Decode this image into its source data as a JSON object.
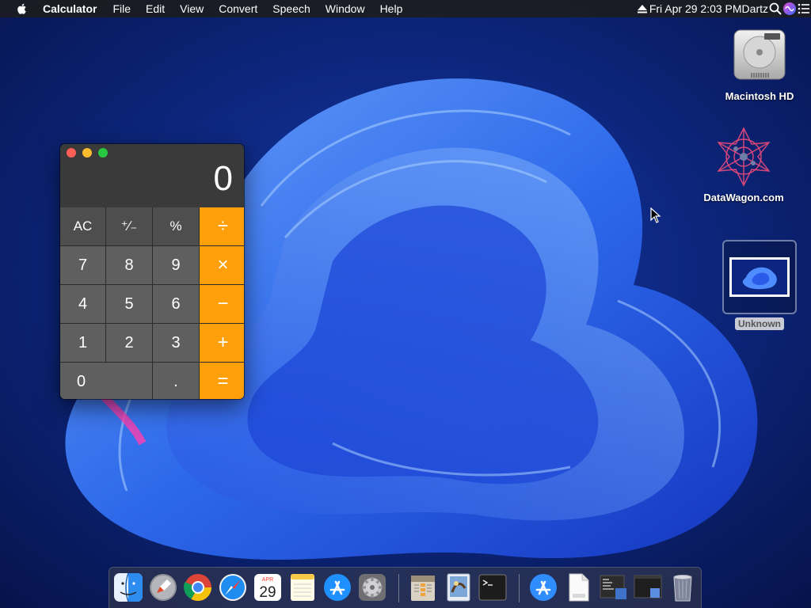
{
  "menubar": {
    "app_name": "Calculator",
    "menus": [
      "File",
      "Edit",
      "View",
      "Convert",
      "Speech",
      "Window",
      "Help"
    ],
    "clock": "Fri Apr 29  2:03 PM",
    "user": "Dartz",
    "icons": [
      "apple-icon",
      "eject-icon",
      "search-icon",
      "siri-icon",
      "control-center-icon"
    ]
  },
  "desktop": {
    "icons": [
      {
        "label": "Macintosh HD",
        "icon": "hard-drive-icon"
      },
      {
        "label": "DataWagon.com",
        "icon": "network-icon"
      },
      {
        "label": "Unknown",
        "icon": "image-thumbnail-icon"
      }
    ]
  },
  "calculator": {
    "display": "0",
    "keys": [
      {
        "label": "AC",
        "kind": "fn"
      },
      {
        "label": "⁺∕₋",
        "kind": "fn"
      },
      {
        "label": "%",
        "kind": "fn"
      },
      {
        "label": "÷",
        "kind": "op"
      },
      {
        "label": "7",
        "kind": "num"
      },
      {
        "label": "8",
        "kind": "num"
      },
      {
        "label": "9",
        "kind": "num"
      },
      {
        "label": "×",
        "kind": "op"
      },
      {
        "label": "4",
        "kind": "num"
      },
      {
        "label": "5",
        "kind": "num"
      },
      {
        "label": "6",
        "kind": "num"
      },
      {
        "label": "−",
        "kind": "op"
      },
      {
        "label": "1",
        "kind": "num"
      },
      {
        "label": "2",
        "kind": "num"
      },
      {
        "label": "3",
        "kind": "num"
      },
      {
        "label": "+",
        "kind": "op"
      },
      {
        "label": "0",
        "kind": "num"
      },
      {
        "label": ".",
        "kind": "num"
      },
      {
        "label": "=",
        "kind": "op"
      }
    ],
    "colors": {
      "operator": "#ff9f0a",
      "number": "#5f5f5f",
      "function": "#4e4e4e"
    }
  },
  "dock": {
    "calendar": {
      "month": "APR",
      "day": "29"
    },
    "items": [
      {
        "name": "finder",
        "running": true
      },
      {
        "name": "launchpad",
        "running": false
      },
      {
        "name": "chrome",
        "running": true
      },
      {
        "name": "safari",
        "running": true
      },
      {
        "name": "calendar",
        "running": false
      },
      {
        "name": "notes",
        "running": false
      },
      {
        "name": "app-store",
        "running": false
      },
      {
        "name": "system-preferences",
        "running": false
      },
      {
        "name": "archive-utility",
        "running": true
      },
      {
        "name": "preview",
        "running": false
      },
      {
        "name": "terminal",
        "running": true
      },
      {
        "name": "applications-folder",
        "running": false
      },
      {
        "name": "document",
        "running": false
      },
      {
        "name": "window-1",
        "running": false
      },
      {
        "name": "window-2",
        "running": false
      },
      {
        "name": "trash",
        "running": false
      }
    ]
  }
}
